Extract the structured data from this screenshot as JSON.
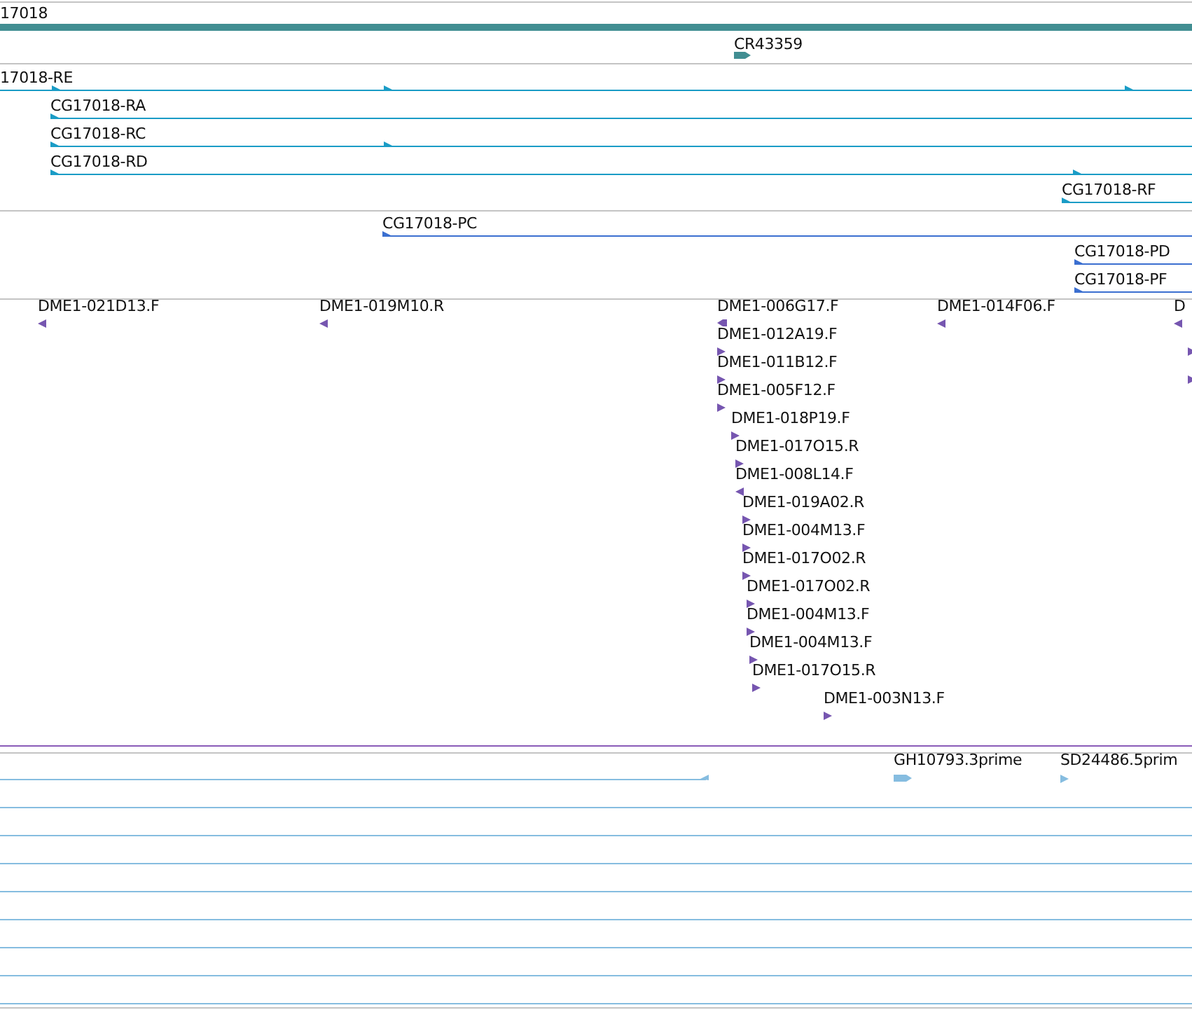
{
  "tracks": [
    {
      "kind": "gene",
      "features": [
        {
          "label": "17018",
          "kind": "bar"
        },
        {
          "label": "CR43359",
          "kind": "block",
          "forward": true
        }
      ]
    },
    {
      "kind": "transcript",
      "features": [
        {
          "label": "17018-RE",
          "kind": "line",
          "forward": true
        },
        {
          "label": "CG17018-RA",
          "kind": "line",
          "forward": true
        },
        {
          "label": "CG17018-RC",
          "kind": "line",
          "forward": true
        },
        {
          "label": "CG17018-RD",
          "kind": "line",
          "forward": true
        },
        {
          "label": "CG17018-RF",
          "kind": "line",
          "forward": true
        }
      ]
    },
    {
      "kind": "protein",
      "features": [
        {
          "label": "CG17018-PC",
          "kind": "line",
          "forward": true
        },
        {
          "label": "CG17018-PD",
          "kind": "line",
          "forward": true
        },
        {
          "label": "CG17018-PF",
          "kind": "line",
          "forward": true
        }
      ]
    },
    {
      "kind": "est",
      "features": [
        {
          "label": "DME1-021D13.F",
          "kind": "marker",
          "forward": false
        },
        {
          "label": "DME1-019M10.R",
          "kind": "marker",
          "forward": false
        },
        {
          "label": "DME1-006G17.F",
          "kind": "block",
          "forward": false
        },
        {
          "label": "DME1-014F06.F",
          "kind": "marker",
          "forward": false
        },
        {
          "label": "D",
          "kind": "marker",
          "forward": false
        },
        {
          "label": "DME1-012A19.F",
          "kind": "marker",
          "forward": true
        },
        {
          "kind": "marker",
          "forward": true
        },
        {
          "label": "DME1-011B12.F",
          "kind": "marker",
          "forward": true
        },
        {
          "kind": "marker",
          "forward": true
        },
        {
          "label": "DME1-005F12.F",
          "kind": "marker",
          "forward": true
        },
        {
          "label": "DME1-018P19.F",
          "kind": "marker",
          "forward": true
        },
        {
          "label": "DME1-017O15.R",
          "kind": "marker",
          "forward": true
        },
        {
          "label": "DME1-008L14.F",
          "kind": "marker",
          "forward": false
        },
        {
          "label": "DME1-019A02.R",
          "kind": "marker",
          "forward": true
        },
        {
          "label": "DME1-004M13.F",
          "kind": "marker",
          "forward": true
        },
        {
          "label": "DME1-017O02.R",
          "kind": "marker",
          "forward": true
        },
        {
          "label": "DME1-017O02.R",
          "kind": "marker",
          "forward": true
        },
        {
          "label": "DME1-004M13.F",
          "kind": "marker",
          "forward": true
        },
        {
          "label": "DME1-004M13.F",
          "kind": "marker",
          "forward": true
        },
        {
          "label": "DME1-017O15.R",
          "kind": "marker",
          "forward": true
        },
        {
          "label": "DME1-003N13.F",
          "kind": "marker",
          "forward": true
        }
      ]
    },
    {
      "kind": "cdna",
      "features": [
        {
          "kind": "line",
          "forward": false
        },
        {
          "label": "GH10793.3prime",
          "kind": "block",
          "forward": true
        },
        {
          "label": "SD24486.5prim",
          "kind": "marker",
          "forward": true
        },
        {
          "kind": "line"
        },
        {
          "kind": "line"
        },
        {
          "kind": "line"
        },
        {
          "kind": "line"
        },
        {
          "kind": "line"
        },
        {
          "kind": "line"
        },
        {
          "kind": "line"
        },
        {
          "kind": "line"
        }
      ]
    }
  ]
}
